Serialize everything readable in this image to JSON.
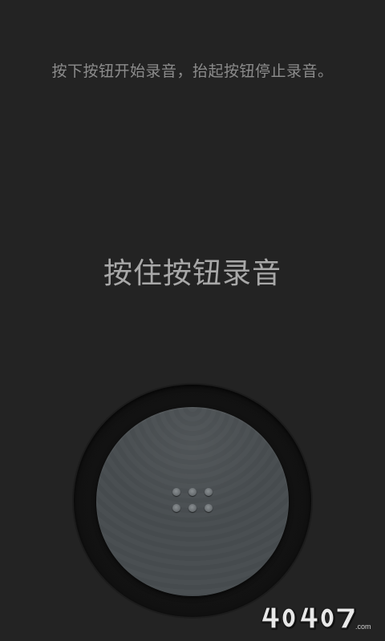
{
  "instruction": "按下按钮开始录音，抬起按钮停止录音。",
  "hold_label": "按住按钮录音",
  "watermark": {
    "text": "4O4O7",
    "suffix": ".com"
  }
}
